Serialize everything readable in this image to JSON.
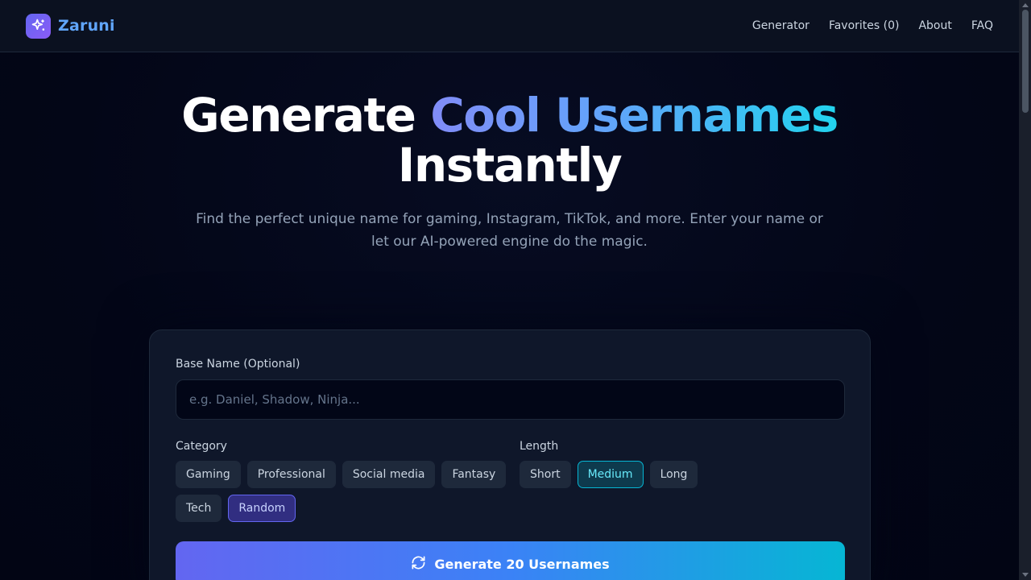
{
  "header": {
    "brand": "Zaruni",
    "logo_icon": "sparkles-icon",
    "nav": [
      {
        "label": "Generator"
      },
      {
        "label": "Favorites (0)"
      },
      {
        "label": "About"
      },
      {
        "label": "FAQ"
      }
    ]
  },
  "hero": {
    "title_prefix": "Generate",
    "title_highlight": "Cool Usernames",
    "title_suffix": "Instantly",
    "subtitle": "Find the perfect unique name for gaming, Instagram, TikTok, and more. Enter your name or let our AI-powered engine do the magic."
  },
  "form": {
    "base_name_label": "Base Name (Optional)",
    "base_name_placeholder": "e.g. Daniel, Shadow, Ninja...",
    "base_name_value": "",
    "category_label": "Category",
    "categories": [
      "Gaming",
      "Professional",
      "Social media",
      "Fantasy",
      "Tech",
      "Random"
    ],
    "selected_category": "Random",
    "length_label": "Length",
    "lengths": [
      "Short",
      "Medium",
      "Long"
    ],
    "selected_length": "Medium",
    "generate_label": "Generate 20 Usernames",
    "generate_icon": "refresh-icon"
  },
  "colors": {
    "background": "#020617",
    "accent_indigo": "#6366f1",
    "accent_cyan": "#06b6d4",
    "brand_blue": "#60a5fa"
  }
}
